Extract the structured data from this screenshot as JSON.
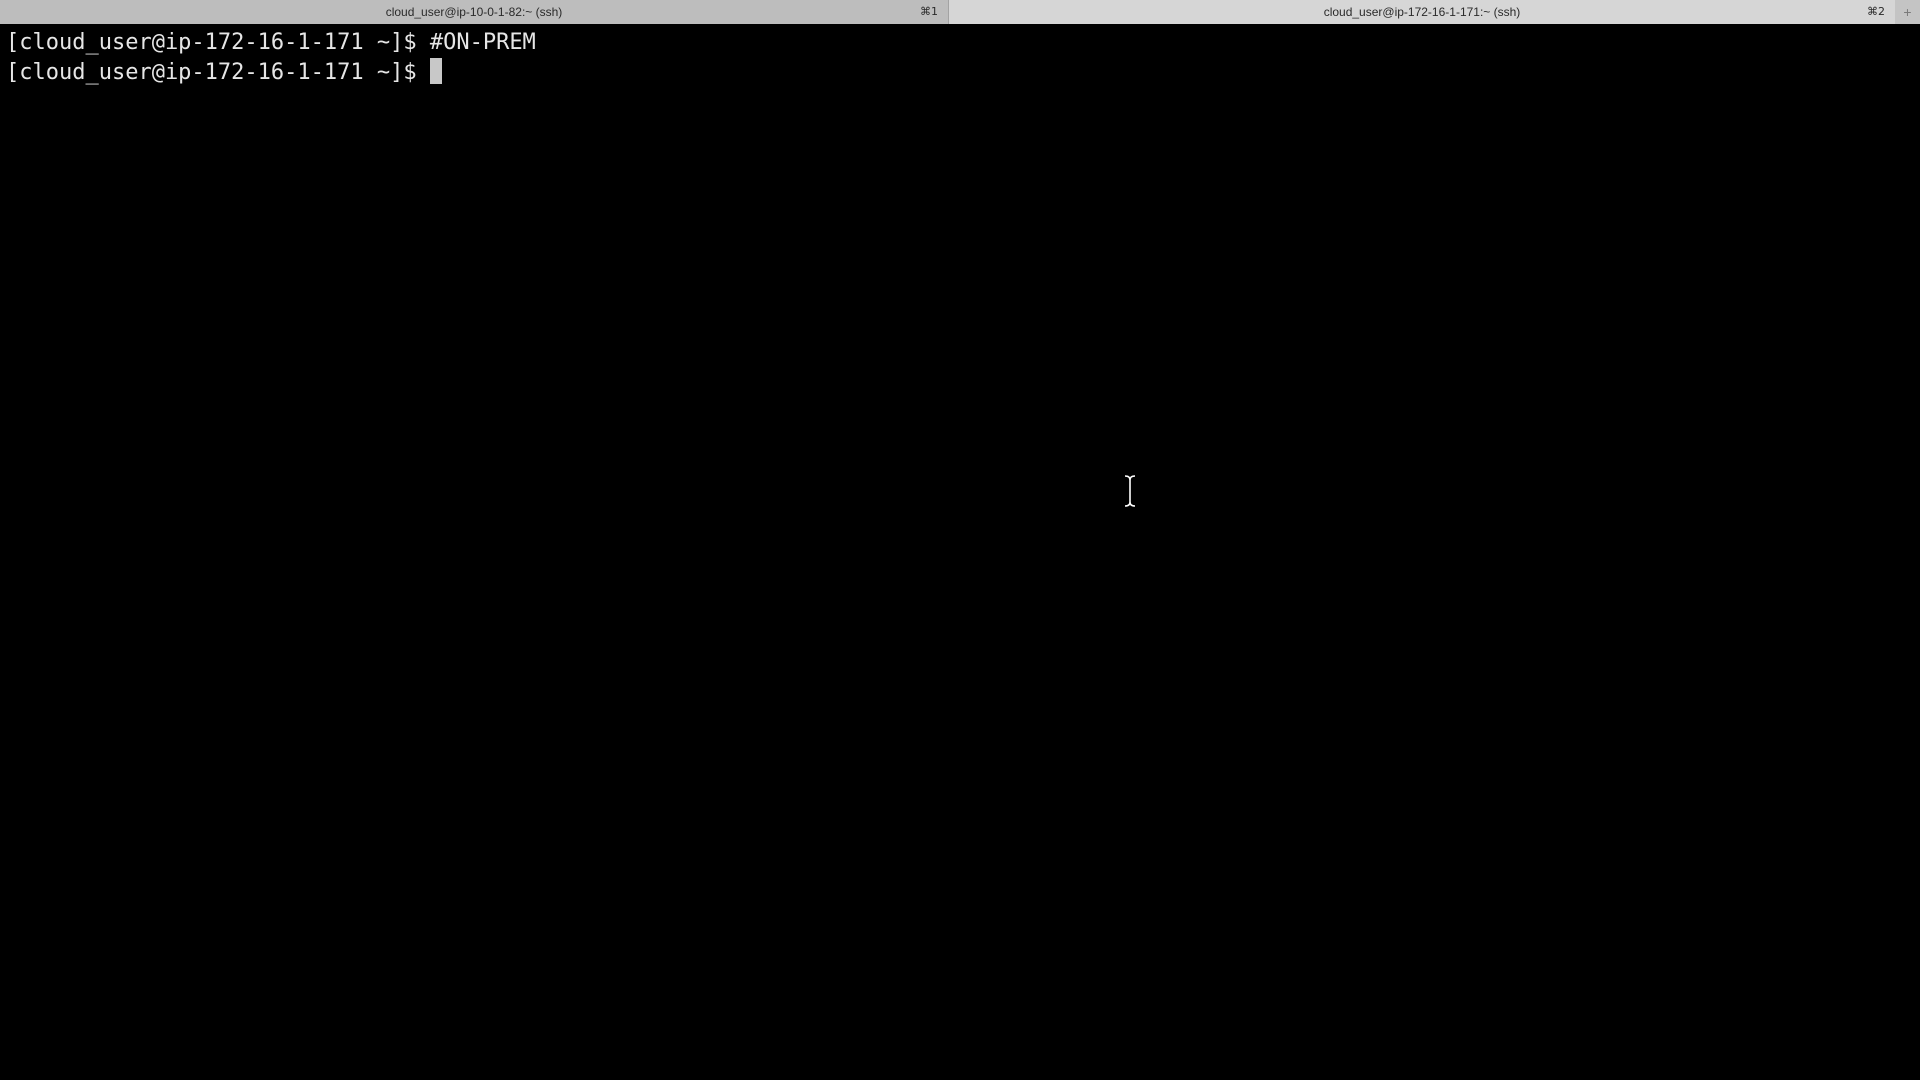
{
  "tabs": [
    {
      "title": "cloud_user@ip-10-0-1-82:~ (ssh)",
      "shortcut": "⌘1"
    },
    {
      "title": "cloud_user@ip-172-16-1-171:~ (ssh)",
      "shortcut": "⌘2"
    }
  ],
  "new_tab_label": "+",
  "terminal": {
    "lines": [
      "[cloud_user@ip-172-16-1-171 ~]$ #ON-PREM",
      "[cloud_user@ip-172-16-1-171 ~]$ "
    ]
  },
  "icons": {
    "cursor": "block-cursor",
    "pointer": "ibeam-pointer-icon"
  },
  "colors": {
    "background": "#000000",
    "text": "#e6e6e6",
    "tabbar": "#c9c9c9"
  }
}
